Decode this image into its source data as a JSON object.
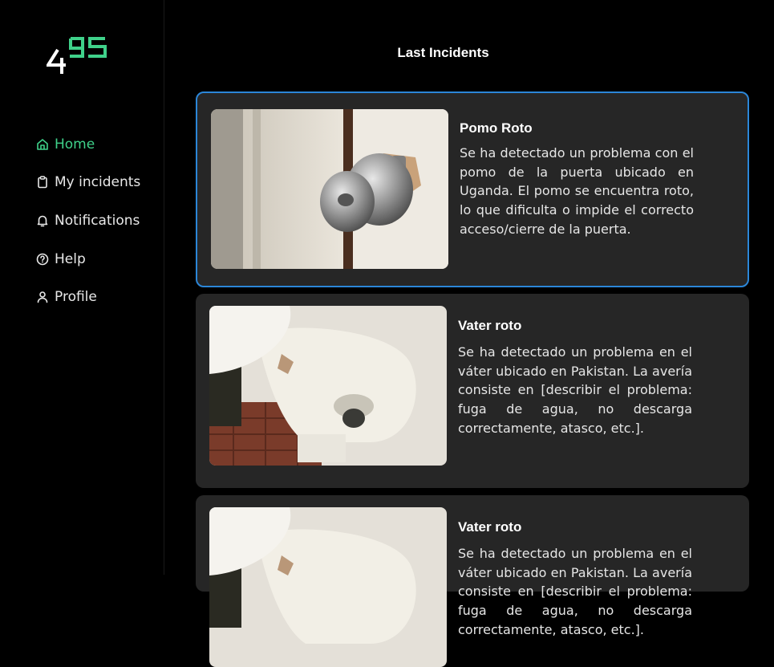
{
  "app": {
    "logo_text": "495"
  },
  "sidebar": {
    "items": [
      {
        "label": "Home",
        "icon": "home-icon",
        "active": true
      },
      {
        "label": "My incidents",
        "icon": "clipboard-icon",
        "active": false
      },
      {
        "label": "Notifications",
        "icon": "bell-icon",
        "active": false
      },
      {
        "label": "Help",
        "icon": "help-circle-icon",
        "active": false
      },
      {
        "label": "Profile",
        "icon": "user-icon",
        "active": false
      }
    ]
  },
  "main": {
    "title": "Last Incidents",
    "incidents": [
      {
        "title": "Pomo Roto",
        "description": "Se ha detectado un problema con el pomo de la puerta ubicado en Uganda. El pomo se encuentra roto, lo que dificulta o impide el correcto acceso/cierre de la puerta.",
        "image": "broken-door-knob-photo"
      },
      {
        "title": "Vater roto",
        "description": "Se ha detectado un problema en el váter ubicado en Pakistan. La avería consiste en [describir el problema: fuga de agua, no descarga correctamente, atasco, etc.].",
        "image": "broken-toilet-photo"
      },
      {
        "title": "Vater roto",
        "description": "Se ha detectado un problema en el váter ubicado en Pakistan. La avería consiste en [describir el problema: fuga de agua, no descarga correctamente, atasco, etc.].",
        "image": "broken-toilet-photo"
      }
    ]
  },
  "colors": {
    "background": "#000000",
    "card": "#262626",
    "accent_green": "#3fd18a",
    "selected_border": "#2b86d8"
  }
}
